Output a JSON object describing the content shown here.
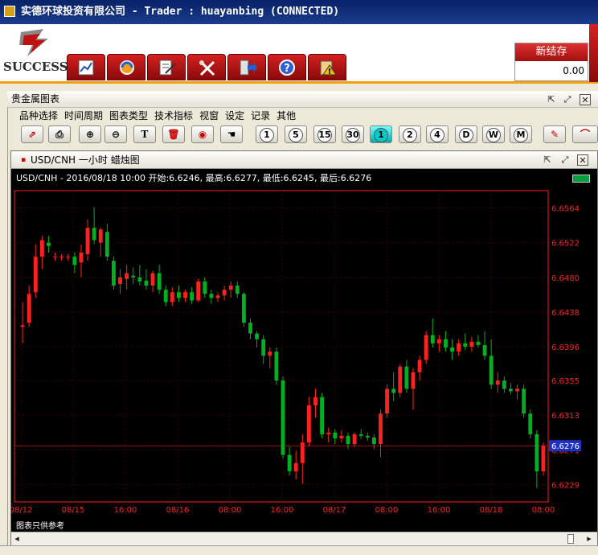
{
  "window": {
    "title": "实德环球投资有限公司 -  Trader : huayanbing (CONNECTED)"
  },
  "logo": {
    "text": "SUCCESS"
  },
  "balance": {
    "label": "新结存",
    "value": "0.00"
  },
  "panel": {
    "title": "贵金属图表"
  },
  "menu": [
    "品种选择",
    "时间周期",
    "图表类型",
    "技术指标",
    "视窗",
    "设定",
    "记录",
    "其他"
  ],
  "timeframe_buttons": [
    "1",
    "5",
    "15",
    "30",
    "1",
    "2",
    "4",
    "D",
    "W",
    "M"
  ],
  "chart_window": {
    "title": "USD/CNH 一小时 蜡烛图"
  },
  "info_line": "USD/CNH - 2016/08/18 10:00 开始:6.6246, 最高:6.6277, 最低:6.6245, 最后:6.6276",
  "status_text": "图表只供参考",
  "colors": {
    "up": "#ff2020",
    "down": "#00b020",
    "axis": "#ff2020",
    "grid": "#3a0000",
    "last_label_bg": "#2030c0"
  },
  "chart_data": {
    "type": "candlestick",
    "symbol": "USD/CNH",
    "ylim": [
      6.6208,
      6.6585
    ],
    "y_ticks": [
      "6.6564",
      "6.6522",
      "6.6480",
      "6.6438",
      "6.6396",
      "6.6355",
      "6.6313",
      "6.6271",
      "6.6229"
    ],
    "x_labels": [
      "08/12",
      "08/15",
      "16:00",
      "08/16",
      "08:00",
      "16:00",
      "08/17",
      "08:00",
      "16:00",
      "08/18",
      "08:00"
    ],
    "last_price": "6.6276",
    "candles": [
      {
        "o": 6.642,
        "h": 6.645,
        "l": 6.64,
        "c": 6.6422
      },
      {
        "o": 6.6425,
        "h": 6.647,
        "l": 6.642,
        "c": 6.646
      },
      {
        "o": 6.6462,
        "h": 6.652,
        "l": 6.6455,
        "c": 6.6505
      },
      {
        "o": 6.6505,
        "h": 6.653,
        "l": 6.649,
        "c": 6.6525
      },
      {
        "o": 6.6522,
        "h": 6.653,
        "l": 6.651,
        "c": 6.6518
      },
      {
        "o": 6.6505,
        "h": 6.651,
        "l": 6.65,
        "c": 6.6505
      },
      {
        "o": 6.6505,
        "h": 6.6508,
        "l": 6.65,
        "c": 6.6505
      },
      {
        "o": 6.6505,
        "h": 6.6508,
        "l": 6.65,
        "c": 6.6505
      },
      {
        "o": 6.6505,
        "h": 6.651,
        "l": 6.6485,
        "c": 6.6495
      },
      {
        "o": 6.6498,
        "h": 6.652,
        "l": 6.648,
        "c": 6.651
      },
      {
        "o": 6.6508,
        "h": 6.655,
        "l": 6.65,
        "c": 6.654
      },
      {
        "o": 6.654,
        "h": 6.6565,
        "l": 6.652,
        "c": 6.6525
      },
      {
        "o": 6.6522,
        "h": 6.654,
        "l": 6.6505,
        "c": 6.6538
      },
      {
        "o": 6.6535,
        "h": 6.6545,
        "l": 6.65,
        "c": 6.6505
      },
      {
        "o": 6.65,
        "h": 6.6505,
        "l": 6.6465,
        "c": 6.647
      },
      {
        "o": 6.6472,
        "h": 6.649,
        "l": 6.646,
        "c": 6.648
      },
      {
        "o": 6.6478,
        "h": 6.6495,
        "l": 6.6465,
        "c": 6.6485
      },
      {
        "o": 6.6482,
        "h": 6.6492,
        "l": 6.6472,
        "c": 6.648
      },
      {
        "o": 6.648,
        "h": 6.6495,
        "l": 6.647,
        "c": 6.6475
      },
      {
        "o": 6.6476,
        "h": 6.649,
        "l": 6.6465,
        "c": 6.647
      },
      {
        "o": 6.647,
        "h": 6.6488,
        "l": 6.6462,
        "c": 6.6485
      },
      {
        "o": 6.6485,
        "h": 6.6495,
        "l": 6.646,
        "c": 6.6465
      },
      {
        "o": 6.6465,
        "h": 6.647,
        "l": 6.6445,
        "c": 6.645
      },
      {
        "o": 6.645,
        "h": 6.6468,
        "l": 6.6445,
        "c": 6.6462
      },
      {
        "o": 6.6462,
        "h": 6.647,
        "l": 6.645,
        "c": 6.6455
      },
      {
        "o": 6.6455,
        "h": 6.6465,
        "l": 6.645,
        "c": 6.6462
      },
      {
        "o": 6.6462,
        "h": 6.6468,
        "l": 6.6448,
        "c": 6.6452
      },
      {
        "o": 6.6452,
        "h": 6.6478,
        "l": 6.645,
        "c": 6.6475
      },
      {
        "o": 6.6475,
        "h": 6.648,
        "l": 6.6455,
        "c": 6.646
      },
      {
        "o": 6.646,
        "h": 6.6465,
        "l": 6.6448,
        "c": 6.6455
      },
      {
        "o": 6.6455,
        "h": 6.6462,
        "l": 6.645,
        "c": 6.6458
      },
      {
        "o": 6.6458,
        "h": 6.647,
        "l": 6.6452,
        "c": 6.6465
      },
      {
        "o": 6.6465,
        "h": 6.6475,
        "l": 6.6455,
        "c": 6.647
      },
      {
        "o": 6.647,
        "h": 6.6475,
        "l": 6.6455,
        "c": 6.646
      },
      {
        "o": 6.646,
        "h": 6.6462,
        "l": 6.642,
        "c": 6.6425
      },
      {
        "o": 6.6425,
        "h": 6.643,
        "l": 6.6405,
        "c": 6.6412
      },
      {
        "o": 6.6412,
        "h": 6.6415,
        "l": 6.6395,
        "c": 6.6405
      },
      {
        "o": 6.6405,
        "h": 6.641,
        "l": 6.6375,
        "c": 6.6385
      },
      {
        "o": 6.6385,
        "h": 6.6395,
        "l": 6.637,
        "c": 6.639
      },
      {
        "o": 6.639,
        "h": 6.6395,
        "l": 6.635,
        "c": 6.6355
      },
      {
        "o": 6.6355,
        "h": 6.636,
        "l": 6.626,
        "c": 6.6265
      },
      {
        "o": 6.6265,
        "h": 6.6275,
        "l": 6.624,
        "c": 6.6245
      },
      {
        "o": 6.6245,
        "h": 6.627,
        "l": 6.6235,
        "c": 6.6255
      },
      {
        "o": 6.6255,
        "h": 6.629,
        "l": 6.623,
        "c": 6.628
      },
      {
        "o": 6.628,
        "h": 6.6335,
        "l": 6.6275,
        "c": 6.6325
      },
      {
        "o": 6.6325,
        "h": 6.6345,
        "l": 6.631,
        "c": 6.6335
      },
      {
        "o": 6.6335,
        "h": 6.634,
        "l": 6.6285,
        "c": 6.629
      },
      {
        "o": 6.629,
        "h": 6.6298,
        "l": 6.628,
        "c": 6.6292
      },
      {
        "o": 6.6292,
        "h": 6.6296,
        "l": 6.6278,
        "c": 6.6285
      },
      {
        "o": 6.6285,
        "h": 6.6295,
        "l": 6.628,
        "c": 6.6288
      },
      {
        "o": 6.6288,
        "h": 6.6292,
        "l": 6.6272,
        "c": 6.6278
      },
      {
        "o": 6.6278,
        "h": 6.6292,
        "l": 6.6274,
        "c": 6.629
      },
      {
        "o": 6.629,
        "h": 6.6296,
        "l": 6.6284,
        "c": 6.6288
      },
      {
        "o": 6.6288,
        "h": 6.6292,
        "l": 6.6282,
        "c": 6.6286
      },
      {
        "o": 6.6286,
        "h": 6.629,
        "l": 6.6272,
        "c": 6.6278
      },
      {
        "o": 6.6278,
        "h": 6.632,
        "l": 6.6262,
        "c": 6.6315
      },
      {
        "o": 6.6315,
        "h": 6.635,
        "l": 6.631,
        "c": 6.6345
      },
      {
        "o": 6.6345,
        "h": 6.6365,
        "l": 6.633,
        "c": 6.634
      },
      {
        "o": 6.634,
        "h": 6.6375,
        "l": 6.6335,
        "c": 6.6372
      },
      {
        "o": 6.6372,
        "h": 6.638,
        "l": 6.634,
        "c": 6.6345
      },
      {
        "o": 6.6345,
        "h": 6.637,
        "l": 6.632,
        "c": 6.6365
      },
      {
        "o": 6.6365,
        "h": 6.6385,
        "l": 6.6355,
        "c": 6.638
      },
      {
        "o": 6.638,
        "h": 6.6415,
        "l": 6.6375,
        "c": 6.641
      },
      {
        "o": 6.641,
        "h": 6.643,
        "l": 6.6395,
        "c": 6.64
      },
      {
        "o": 6.64,
        "h": 6.641,
        "l": 6.639,
        "c": 6.6405
      },
      {
        "o": 6.6405,
        "h": 6.6415,
        "l": 6.639,
        "c": 6.6395
      },
      {
        "o": 6.6395,
        "h": 6.6405,
        "l": 6.638,
        "c": 6.639
      },
      {
        "o": 6.639,
        "h": 6.6405,
        "l": 6.6385,
        "c": 6.64
      },
      {
        "o": 6.64,
        "h": 6.6412,
        "l": 6.6392,
        "c": 6.6396
      },
      {
        "o": 6.6396,
        "h": 6.6408,
        "l": 6.639,
        "c": 6.6402
      },
      {
        "o": 6.6402,
        "h": 6.641,
        "l": 6.6395,
        "c": 6.6398
      },
      {
        "o": 6.6398,
        "h": 6.6415,
        "l": 6.638,
        "c": 6.6385
      },
      {
        "o": 6.6385,
        "h": 6.6405,
        "l": 6.6345,
        "c": 6.635
      },
      {
        "o": 6.635,
        "h": 6.6365,
        "l": 6.634,
        "c": 6.6355
      },
      {
        "o": 6.6355,
        "h": 6.636,
        "l": 6.634,
        "c": 6.6345
      },
      {
        "o": 6.6345,
        "h": 6.6352,
        "l": 6.6338,
        "c": 6.6342
      },
      {
        "o": 6.6342,
        "h": 6.635,
        "l": 6.6332,
        "c": 6.6345
      },
      {
        "o": 6.6345,
        "h": 6.635,
        "l": 6.631,
        "c": 6.6315
      },
      {
        "o": 6.6315,
        "h": 6.632,
        "l": 6.6285,
        "c": 6.629
      },
      {
        "o": 6.629,
        "h": 6.6295,
        "l": 6.6225,
        "c": 6.6245
      },
      {
        "o": 6.6245,
        "h": 6.628,
        "l": 6.624,
        "c": 6.6276
      }
    ]
  }
}
